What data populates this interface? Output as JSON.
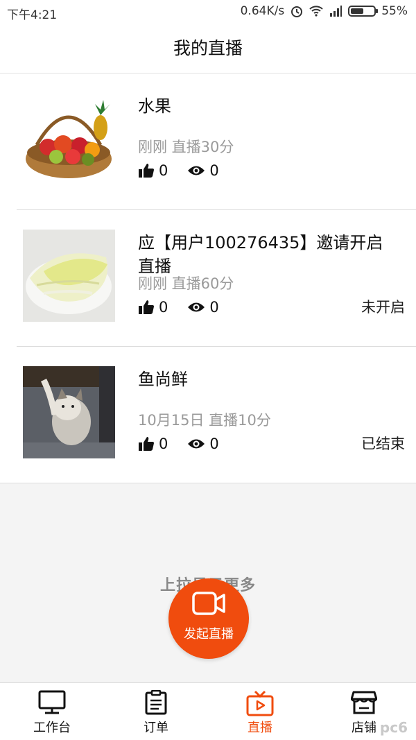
{
  "status_bar": {
    "time": "下午4:21",
    "net_speed": "0.64K/s",
    "battery": "55%",
    "battery_level": 0.55
  },
  "header": {
    "title": "我的直播"
  },
  "broadcasts": [
    {
      "title": "水果",
      "meta": "刚刚 直播30分",
      "likes": "0",
      "views": "0",
      "state": ""
    },
    {
      "title": "应【用户100276435】邀请开启直播",
      "meta": "刚刚 直播60分",
      "likes": "0",
      "views": "0",
      "state": "未开启"
    },
    {
      "title": "鱼尚鲜",
      "meta": "10月15日 直播10分",
      "likes": "0",
      "views": "0",
      "state": "已结束"
    }
  ],
  "load_more": "上拉显示更多",
  "fab": {
    "label": "发起直播"
  },
  "tabs": [
    {
      "label": "工作台",
      "icon": "monitor-icon"
    },
    {
      "label": "订单",
      "icon": "clipboard-icon"
    },
    {
      "label": "直播",
      "icon": "tv-play-icon"
    },
    {
      "label": "店铺",
      "icon": "store-icon"
    }
  ],
  "watermark": "pc6",
  "colors": {
    "accent": "#f04c0e",
    "divider": "#dcdcdc",
    "meta": "#9a9a9a"
  }
}
